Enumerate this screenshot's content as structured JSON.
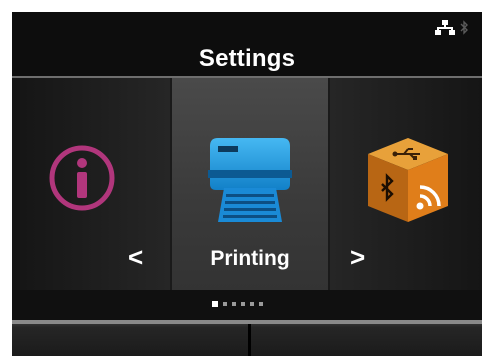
{
  "header": {
    "title": "Settings",
    "status_icons": [
      "network-icon",
      "bluetooth-icon"
    ]
  },
  "carousel": {
    "items": [
      {
        "name": "info",
        "icon": "info-icon",
        "label": "",
        "color": "#b1367c"
      },
      {
        "name": "printing",
        "icon": "printer-icon",
        "label": "Printing",
        "color": "#1e9ae0",
        "selected": true
      },
      {
        "name": "interface",
        "icon": "interface-cube-icon",
        "label": "",
        "color": "#e08a1e"
      }
    ],
    "prev_arrow": "<",
    "next_arrow": ">"
  },
  "pagination": {
    "total": 6,
    "current": 1
  },
  "softkeys": {
    "left_label": "",
    "right_label": ""
  },
  "colors": {
    "background": "#0d0d0d",
    "accent_blue": "#1e9ae0",
    "accent_magenta": "#b1367c",
    "accent_orange": "#e08a1e"
  }
}
